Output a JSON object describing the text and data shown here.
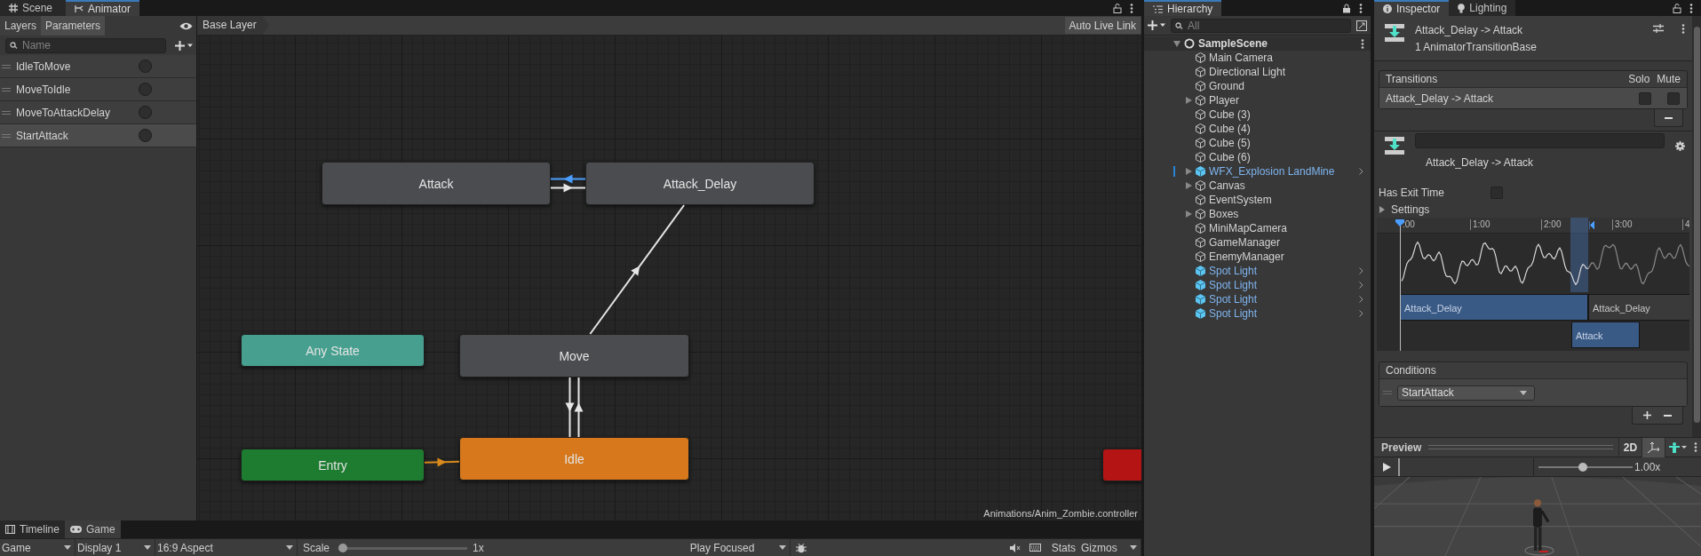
{
  "editor_tabs": [
    {
      "label": "Scene",
      "selected": false
    },
    {
      "label": "Animator",
      "selected": true
    }
  ],
  "animator": {
    "panel_tabs": [
      {
        "label": "Layers",
        "selected": false
      },
      {
        "label": "Parameters",
        "selected": true
      }
    ],
    "search": {
      "placeholder": "Name"
    },
    "parameters": [
      {
        "name": "IdleToMove",
        "selected": false
      },
      {
        "name": "MoveToIdle",
        "selected": false
      },
      {
        "name": "MoveToAttackDelay",
        "selected": false
      },
      {
        "name": "StartAttack",
        "selected": true
      }
    ],
    "breadcrumb": "Base Layer",
    "live_link": "Auto Live Link",
    "states": [
      {
        "label": "Attack",
        "kind": "state"
      },
      {
        "label": "Attack_Delay",
        "kind": "state"
      },
      {
        "label": "Any State",
        "kind": "any"
      },
      {
        "label": "Move",
        "kind": "state"
      },
      {
        "label": "Entry",
        "kind": "entry"
      },
      {
        "label": "Idle",
        "kind": "default"
      },
      {
        "kind": "exit"
      }
    ],
    "transitions": [
      {
        "kind": "normal",
        "selected": true
      },
      {
        "kind": "normal",
        "selected": false
      },
      {
        "kind": "normal",
        "selected": false
      },
      {
        "kind": "normal",
        "selected": false
      },
      {
        "kind": "normal",
        "selected": false
      },
      {
        "kind": "entry",
        "selected": false
      }
    ],
    "asset_path": "Animations/Anim_Zombie.controller"
  },
  "game": {
    "tabs": [
      {
        "label": "Timeline",
        "selected": false
      },
      {
        "label": "Game",
        "selected": true
      }
    ],
    "view": "Game",
    "display": "Display 1",
    "aspect": "16:9 Aspect",
    "scale_label": "Scale",
    "scale": {
      "level": 0
    },
    "scale_value": "1x",
    "play_mode": "Play Focused",
    "stats": "Stats",
    "gizmos": "Gizmos"
  },
  "hierarchy": {
    "title": "Hierarchy",
    "search": {
      "placeholder": "All"
    },
    "scene": "SampleScene",
    "items": [
      {
        "name": "Main Camera",
        "kind": "object",
        "expandable": false,
        "marked": false
      },
      {
        "name": "Directional Light",
        "kind": "object",
        "expandable": false,
        "marked": false
      },
      {
        "name": "Ground",
        "kind": "object",
        "expandable": false,
        "marked": false
      },
      {
        "name": "Player",
        "kind": "object",
        "expandable": true,
        "marked": false
      },
      {
        "name": "Cube (3)",
        "kind": "object",
        "expandable": false,
        "marked": false
      },
      {
        "name": "Cube (4)",
        "kind": "object",
        "expandable": false,
        "marked": false
      },
      {
        "name": "Cube (5)",
        "kind": "object",
        "expandable": false,
        "marked": false
      },
      {
        "name": "Cube (6)",
        "kind": "object",
        "expandable": false,
        "marked": false
      },
      {
        "name": "WFX_Explosion LandMine",
        "kind": "prefab",
        "expandable": true,
        "marked": true
      },
      {
        "name": "Canvas",
        "kind": "object",
        "expandable": true,
        "marked": false
      },
      {
        "name": "EventSystem",
        "kind": "object",
        "expandable": false,
        "marked": false
      },
      {
        "name": "Boxes",
        "kind": "object",
        "expandable": true,
        "marked": false
      },
      {
        "name": "MiniMapCamera",
        "kind": "object",
        "expandable": false,
        "marked": false
      },
      {
        "name": "GameManager",
        "kind": "object",
        "expandable": false,
        "marked": false
      },
      {
        "name": "EnemyManager",
        "kind": "object",
        "expandable": false,
        "marked": false
      },
      {
        "name": "Spot Light",
        "kind": "prefab",
        "expandable": false,
        "marked": false
      },
      {
        "name": "Spot Light",
        "kind": "prefab",
        "expandable": false,
        "marked": false
      },
      {
        "name": "Spot Light",
        "kind": "prefab",
        "expandable": false,
        "marked": false
      },
      {
        "name": "Spot Light",
        "kind": "prefab",
        "expandable": false,
        "marked": false
      }
    ]
  },
  "inspector": {
    "tabs": [
      {
        "label": "Inspector",
        "selected": true
      },
      {
        "label": "Lighting",
        "selected": false
      }
    ],
    "title": "Attack_Delay -> Attack",
    "subtitle": "1 AnimatorTransitionBase",
    "transitions": {
      "heading": "Transitions",
      "solo_label": "Solo",
      "mute_label": "Mute",
      "rows": [
        {
          "name": "Attack_Delay -> Attack",
          "solo": false,
          "mute": false,
          "selected": true
        }
      ]
    },
    "transition_label": "Attack_Delay -> Attack",
    "has_exit_time": {
      "label": "Has Exit Time",
      "checked": false
    },
    "settings": {
      "label": "Settings",
      "expanded": false
    },
    "timeline": {
      "ticks": [
        ":00",
        "1:00",
        "2:00",
        "3:00",
        "4"
      ],
      "clips": [
        {
          "label": "Attack_Delay",
          "kind": "source"
        },
        {
          "label": "Attack_Delay",
          "kind": "source_after"
        },
        {
          "label": "Attack",
          "kind": "destination"
        }
      ]
    },
    "conditions": {
      "heading": "Conditions",
      "items": [
        {
          "parameter": "StartAttack"
        }
      ]
    },
    "preview": {
      "title": "Preview",
      "mode": "2D",
      "speed": {
        "level": 0.47
      },
      "speed_value": "1.00x"
    }
  }
}
